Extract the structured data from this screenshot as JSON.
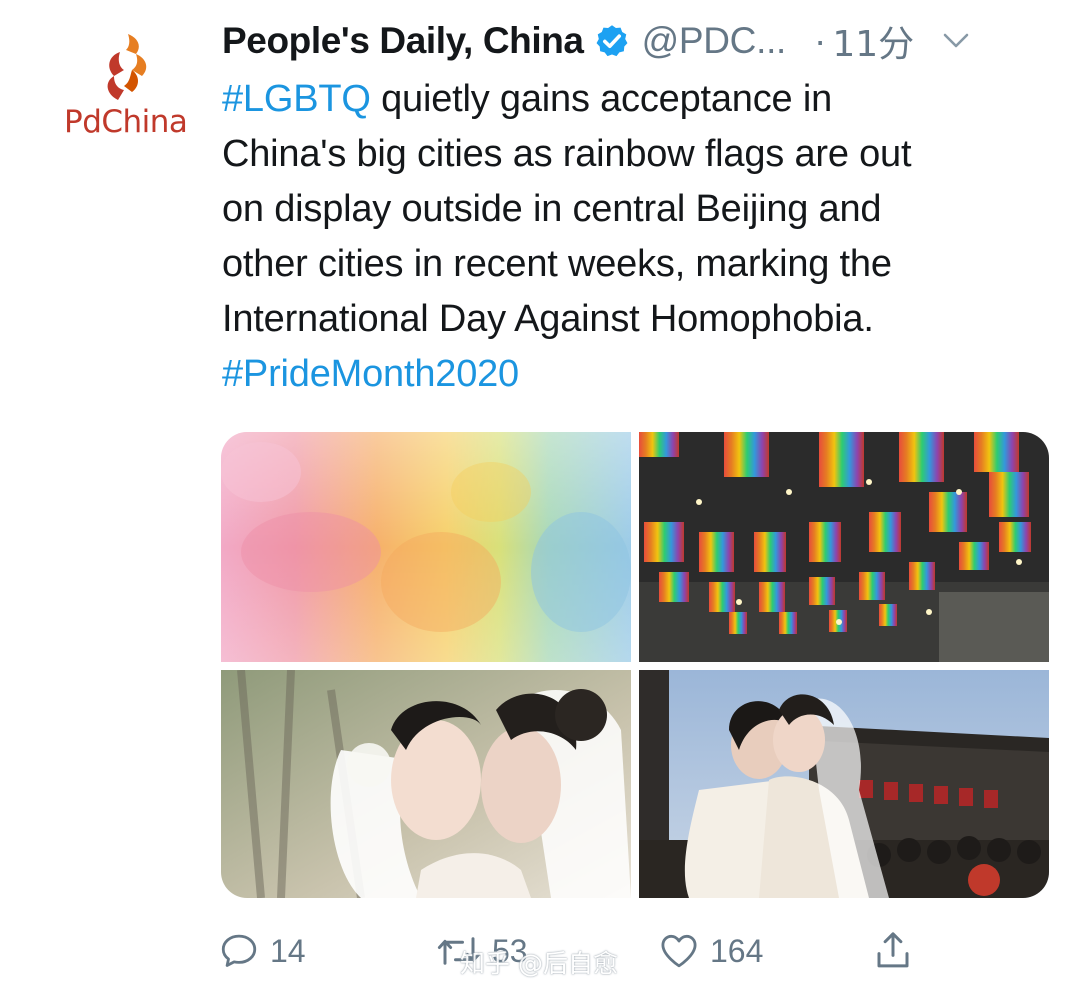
{
  "account": {
    "avatar_wordmark_a": "Pd",
    "avatar_wordmark_b": "China",
    "display_name": "People's Daily, China",
    "handle": "@PDC...",
    "separator": "·",
    "time": "11分",
    "verified": true
  },
  "tweet": {
    "lines": [
      {
        "hashtag": "#LGBTQ",
        "text": " quietly gains acceptance in"
      },
      {
        "text": "China's big cities as rainbow flags are out"
      },
      {
        "text": "on display outside  in central Beijing and"
      },
      {
        "text": "other cities in recent weeks, marking the"
      },
      {
        "text": "International Day Against Homophobia."
      },
      {
        "hashtag": "#PrideMonth2020"
      }
    ]
  },
  "media": [
    {
      "icon": "watercolor-rainbow-image"
    },
    {
      "icon": "rainbow-bunting-flags-image"
    },
    {
      "icon": "brides-kissing-image"
    },
    {
      "icon": "brides-embracing-street-image"
    }
  ],
  "actions": {
    "reply_count": "14",
    "retweet_count": "53",
    "like_count": "164"
  },
  "watermark": "知乎 @后自愈",
  "colors": {
    "link": "#1b95e0",
    "muted": "#657786",
    "text": "#14171a",
    "verified": "#1da1f2",
    "brand_red": "#c0392b",
    "brand_orange": "#e67e22"
  }
}
